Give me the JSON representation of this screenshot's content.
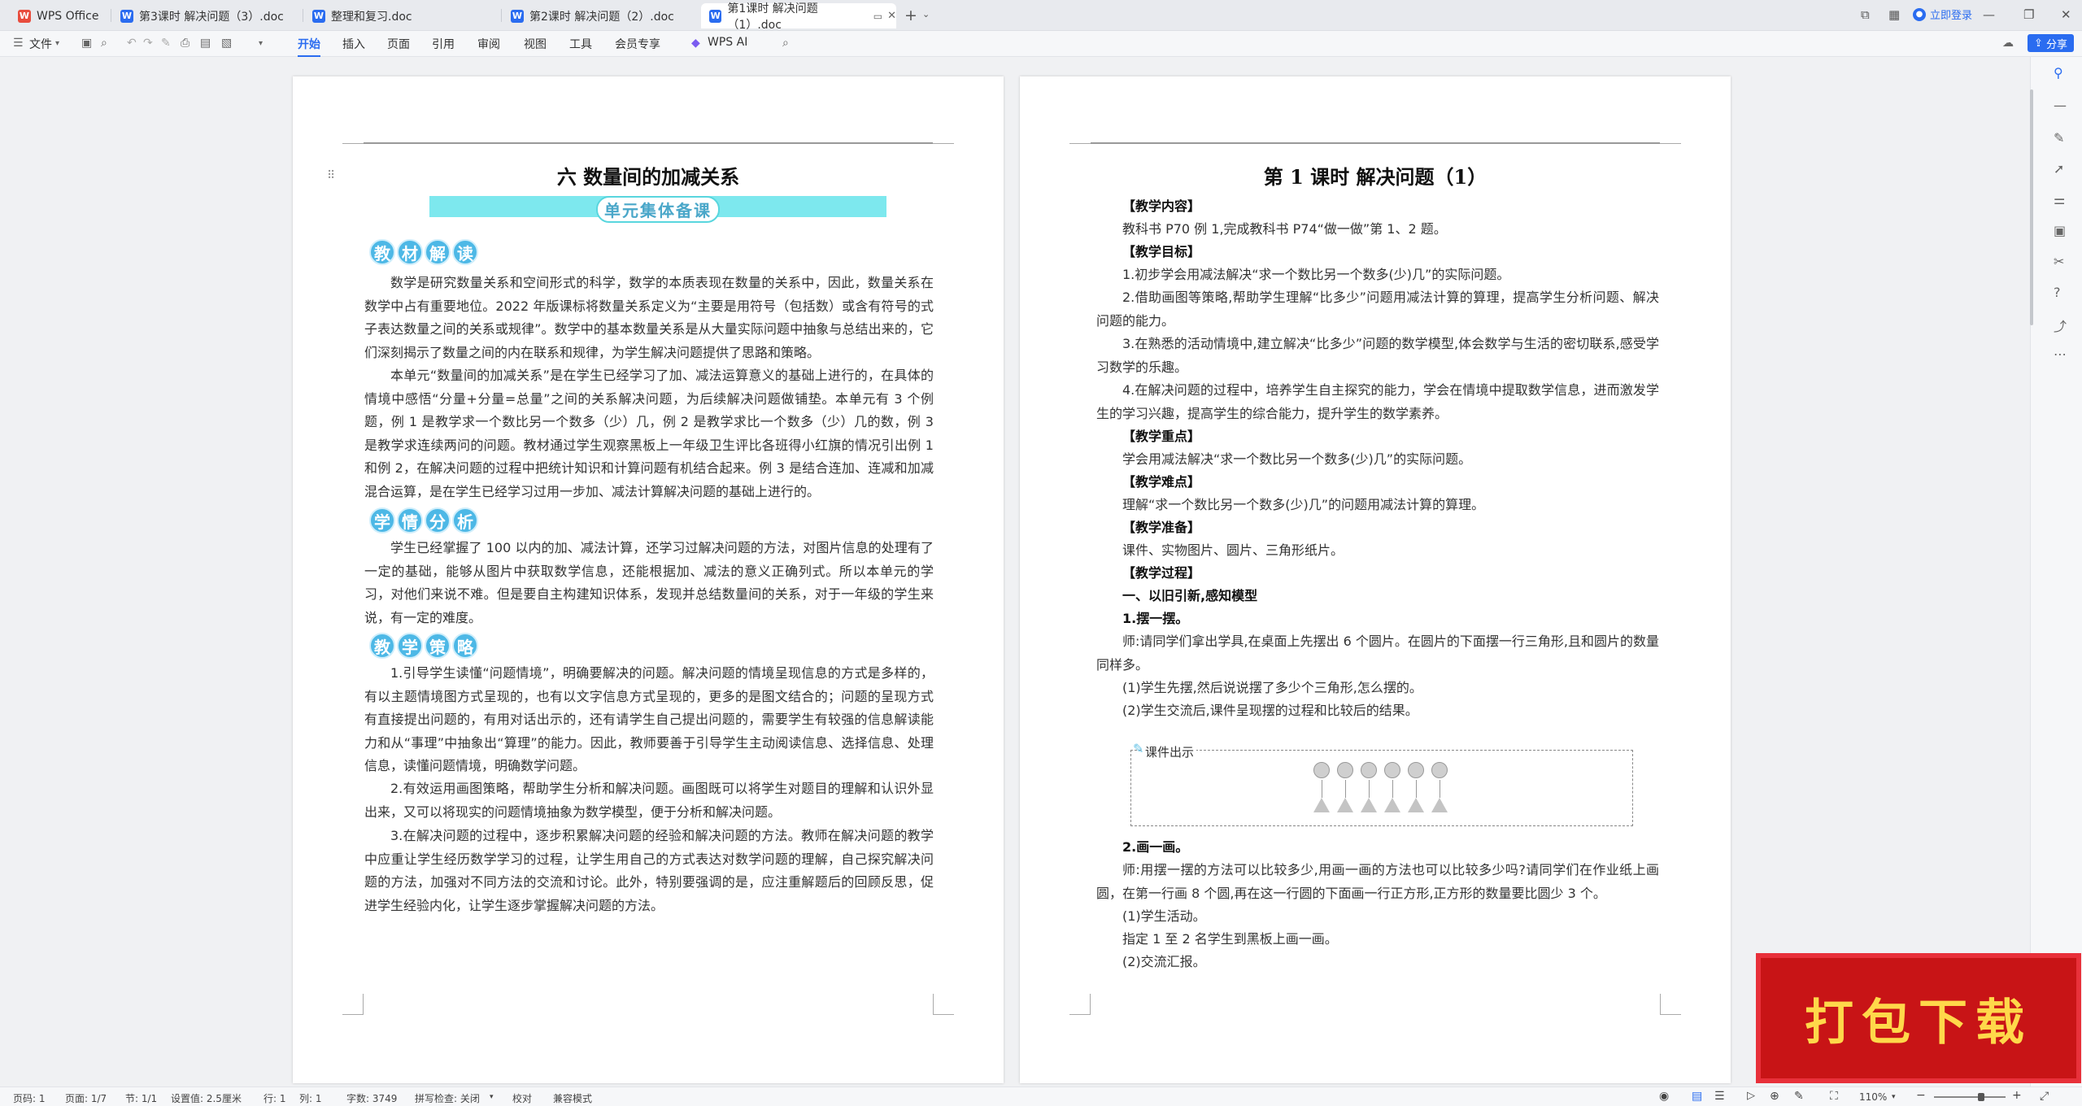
{
  "tabs": [
    {
      "label": "WPS Office",
      "icon": "wps-logo-icon"
    },
    {
      "label": "第3课时  解决问题（3）.doc",
      "icon": "word-doc-icon"
    },
    {
      "label": "整理和复习.doc",
      "icon": "word-doc-icon"
    },
    {
      "label": "第2课时  解决问题（2）.doc",
      "icon": "word-doc-icon"
    },
    {
      "label": "第1课时  解决问题（1）.doc",
      "icon": "word-doc-icon",
      "active": true
    }
  ],
  "login_label": "立即登录",
  "file_menu": "文件",
  "menus": [
    "开始",
    "插入",
    "页面",
    "引用",
    "审阅",
    "视图",
    "工具",
    "会员专享"
  ],
  "wps_ai": "WPS AI",
  "share_label": "分享",
  "left_page": {
    "title": "六    数量间的加减关系",
    "banner": "单元集体备课",
    "sec1": [
      "教",
      "材",
      "解",
      "读"
    ],
    "sec1_paras": [
      "数学是研究数量关系和空间形式的科学，数学的本质表现在数量的关系中，因此，数量关系在数学中占有重要地位。2022 年版课标将数量关系定义为“主要是用符号（包括数）或含有符号的式子表达数量之间的关系或规律”。数学中的基本数量关系是从大量实际问题中抽象与总结出来的，它们深刻揭示了数量之间的内在联系和规律，为学生解决问题提供了思路和策略。",
      "本单元“数量间的加减关系”是在学生已经学习了加、减法运算意义的基础上进行的，在具体的情境中感悟“分量+分量=总量”之间的关系解决问题，为后续解决问题做铺垫。本单元有 3 个例题，例 1 是教学求一个数比另一个数多（少）几，例 2 是教学求比一个数多（少）几的数，例 3 是教学求连续两问的问题。教材通过学生观察黑板上一年级卫生评比各班得小红旗的情况引出例 1 和例 2，在解决问题的过程中把统计知识和计算问题有机结合起来。例 3 是结合连加、连减和加减混合运算，是在学生已经学习过用一步加、减法计算解决问题的基础上进行的。"
    ],
    "sec2": [
      "学",
      "情",
      "分",
      "析"
    ],
    "sec2_paras": [
      "学生已经掌握了 100 以内的加、减法计算，还学习过解决问题的方法，对图片信息的处理有了一定的基础，能够从图片中获取数学信息，还能根据加、减法的意义正确列式。所以本单元的学习，对他们来说不难。但是要自主构建知识体系，发现并总结数量间的关系，对于一年级的学生来说，有一定的难度。"
    ],
    "sec3": [
      "教",
      "学",
      "策",
      "略"
    ],
    "sec3_paras": [
      "1.引导学生读懂“问题情境”，明确要解决的问题。解决问题的情境呈现信息的方式是多样的，有以主题情境图方式呈现的，也有以文字信息方式呈现的，更多的是图文结合的；问题的呈现方式有直接提出问题的，有用对话出示的，还有请学生自己提出问题的，需要学生有较强的信息解读能力和从“事理”中抽象出“算理”的能力。因此，教师要善于引导学生主动阅读信息、选择信息、处理信息，读懂问题情境，明确数学问题。",
      "2.有效运用画图策略，帮助学生分析和解决问题。画图既可以将学生对题目的理解和认识外显出来，又可以将现实的问题情境抽象为数学模型，便于分析和解决问题。",
      "3.在解决问题的过程中，逐步积累解决问题的经验和解决问题的方法。教师在解决问题的教学中应重让学生经历数学学习的过程，让学生用自己的方式表达对数学问题的理解，自己探究解决问题的方法，加强对不同方法的交流和讨论。此外，特别要强调的是，应注重解题后的回顾反思，促进学生经验内化，让学生逐步掌握解决问题的方法。"
    ]
  },
  "right_page": {
    "title": "第 1 课时    解决问题（1）",
    "content_h": "【教学内容】",
    "content": "教科书 P70 例 1,完成教科书 P74“做一做”第 1、2 题。",
    "goal_h": "【教学目标】",
    "goals": [
      "1.初步学会用减法解决“求一个数比另一个数多(少)几”的实际问题。",
      "2.借助画图等策略,帮助学生理解“比多少”问题用减法计算的算理，提高学生分析问题、解决问题的能力。",
      "3.在熟悉的活动情境中,建立解决“比多少”问题的数学模型,体会数学与生活的密切联系,感受学习数学的乐趣。",
      "4.在解决问题的过程中，培养学生自主探究的能力，学会在情境中提取数学信息，进而激发学生的学习兴趣，提高学生的综合能力，提升学生的数学素养。"
    ],
    "key_h": "【教学重点】",
    "key": "学会用减法解决“求一个数比另一个数多(少)几”的实际问题。",
    "diff_h": "【教学难点】",
    "diff": "理解“求一个数比另一个数多(少)几”的问题用减法计算的算理。",
    "prep_h": "【教学准备】",
    "prep": "课件、实物图片、圆片、三角形纸片。",
    "proc_h": "【教学过程】",
    "proc1": "一、以旧引新,感知模型",
    "step1": "1.摆一摆。",
    "step1_text": "师:请同学们拿出学具,在桌面上先摆出 6 个圆片。在圆片的下面摆一行三角形,且和圆片的数量同样多。",
    "step1_a": "(1)学生先摆,然后说说摆了多少个三角形,怎么摆的。",
    "step1_b": "(2)学生交流后,课件呈现摆的过程和比较后的结果。",
    "kj_label": "课件出示",
    "circles": 6,
    "triangles": 6,
    "step2": "2.画一画。",
    "step2_text": "师:用摆一摆的方法可以比较多少,用画一画的方法也可以比较多少吗?请同学们在作业纸上画圆，在第一行画 8 个圆,再在这一行圆的下面画一行正方形,正方形的数量要比圆少 3 个。",
    "step2_a": "(1)学生活动。",
    "step2_b": "指定 1 至 2 名学生到黑板上画一画。",
    "step2_c": "(2)交流汇报。"
  },
  "download_badge": "打包下载",
  "status": {
    "page_code": "页码: 1",
    "page_count": "页面: 1/7",
    "section": "节: 1/1",
    "setting": "设置值: 2.5厘米",
    "row": "行: 1",
    "col": "列: 1",
    "words": "字数: 3749",
    "spell": "拼写检查: 关闭",
    "proof": "校对",
    "compat": "兼容模式",
    "zoom": "110%"
  }
}
